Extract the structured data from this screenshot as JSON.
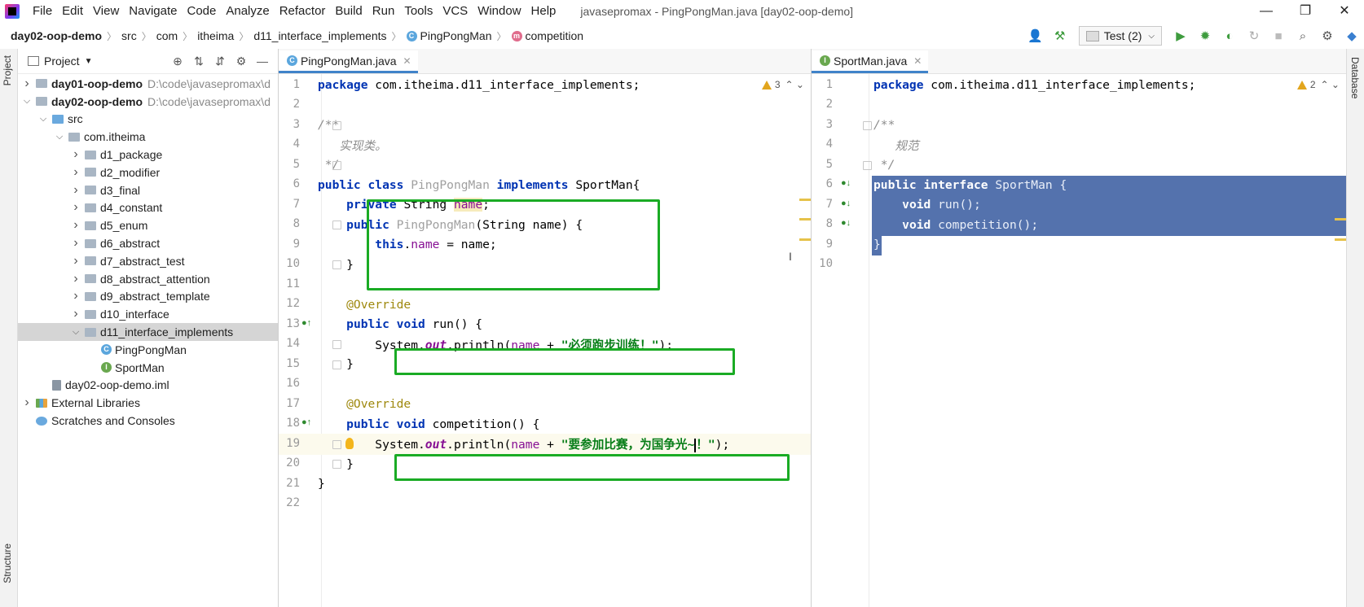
{
  "menubar": {
    "items": [
      "File",
      "Edit",
      "View",
      "Navigate",
      "Code",
      "Analyze",
      "Refactor",
      "Build",
      "Run",
      "Tools",
      "VCS",
      "Window",
      "Help"
    ],
    "title": "javasepromax - PingPongMan.java [day02-oop-demo]",
    "controls": {
      "minimize": "—",
      "restore": "❐",
      "close": "✕"
    }
  },
  "navbar": {
    "crumbs": [
      "day02-oop-demo",
      "src",
      "com",
      "itheima",
      "d11_interface_implements",
      "PingPongMan",
      "competition"
    ],
    "class_icon": "C",
    "method_icon": "m",
    "run_config": "Test (2)"
  },
  "side": {
    "project_tab": "Project",
    "structure_tab": "Structure",
    "database_tab": "Database"
  },
  "project": {
    "title": "Project",
    "tree": [
      {
        "label": "day01-oop-demo",
        "path": "D:\\code\\javasepromax\\d",
        "bold": true,
        "depth": 0,
        "arrow": ">",
        "icon": "folder"
      },
      {
        "label": "day02-oop-demo",
        "path": "D:\\code\\javasepromax\\d",
        "bold": true,
        "depth": 0,
        "arrow": "v",
        "icon": "folder"
      },
      {
        "label": "src",
        "depth": 1,
        "arrow": "v",
        "icon": "src"
      },
      {
        "label": "com.itheima",
        "depth": 2,
        "arrow": "v",
        "icon": "folder"
      },
      {
        "label": "d1_package",
        "depth": 3,
        "arrow": ">",
        "icon": "folder"
      },
      {
        "label": "d2_modifier",
        "depth": 3,
        "arrow": ">",
        "icon": "folder"
      },
      {
        "label": "d3_final",
        "depth": 3,
        "arrow": ">",
        "icon": "folder"
      },
      {
        "label": "d4_constant",
        "depth": 3,
        "arrow": ">",
        "icon": "folder"
      },
      {
        "label": "d5_enum",
        "depth": 3,
        "arrow": ">",
        "icon": "folder"
      },
      {
        "label": "d6_abstract",
        "depth": 3,
        "arrow": ">",
        "icon": "folder"
      },
      {
        "label": "d7_abstract_test",
        "depth": 3,
        "arrow": ">",
        "icon": "folder"
      },
      {
        "label": "d8_abstract_attention",
        "depth": 3,
        "arrow": ">",
        "icon": "folder"
      },
      {
        "label": "d9_abstract_template",
        "depth": 3,
        "arrow": ">",
        "icon": "folder"
      },
      {
        "label": "d10_interface",
        "depth": 3,
        "arrow": ">",
        "icon": "folder"
      },
      {
        "label": "d11_interface_implements",
        "depth": 3,
        "arrow": "v",
        "icon": "folder",
        "selected": true
      },
      {
        "label": "PingPongMan",
        "depth": 4,
        "arrow": "",
        "icon": "class"
      },
      {
        "label": "SportMan",
        "depth": 4,
        "arrow": "",
        "icon": "interface"
      },
      {
        "label": "day02-oop-demo.iml",
        "depth": 1,
        "arrow": "",
        "icon": "file"
      },
      {
        "label": "External Libraries",
        "depth": 0,
        "arrow": ">",
        "icon": "lib"
      },
      {
        "label": "Scratches and Consoles",
        "depth": 0,
        "arrow": "",
        "icon": "scratch"
      }
    ]
  },
  "editor_left": {
    "tab": "PingPongMan.java",
    "warnings": "3",
    "lines": [
      [
        [
          "kw",
          "package "
        ],
        [
          "cls",
          "com.itheima.d11_interface_implements;"
        ]
      ],
      [],
      [
        [
          "cmt",
          "/**"
        ]
      ],
      [
        [
          "cmt",
          "   实现类。"
        ]
      ],
      [
        [
          "cmt",
          " */"
        ]
      ],
      [
        [
          "kw",
          "public class "
        ],
        [
          "cls-un",
          "PingPongMan "
        ],
        [
          "kw",
          "implements "
        ],
        [
          "cls",
          "SportMan{"
        ]
      ],
      [
        [
          "cls",
          "    "
        ],
        [
          "kw",
          "private "
        ],
        [
          "cls",
          "String "
        ],
        [
          "fld-hl",
          "name"
        ],
        [
          "cls",
          ";"
        ]
      ],
      [
        [
          "cls",
          "    "
        ],
        [
          "kw",
          "public "
        ],
        [
          "cls-un",
          "PingPongMan"
        ],
        [
          "cls",
          "(String name) {"
        ]
      ],
      [
        [
          "cls",
          "        "
        ],
        [
          "kw",
          "this"
        ],
        [
          "cls",
          "."
        ],
        [
          "fld",
          "name"
        ],
        [
          "cls",
          " = name;"
        ]
      ],
      [
        [
          "cls",
          "    }"
        ]
      ],
      [],
      [
        [
          "ann",
          "    @Override"
        ]
      ],
      [
        [
          "cls",
          "    "
        ],
        [
          "kw",
          "public void "
        ],
        [
          "cls",
          "run() {"
        ]
      ],
      [
        [
          "cls",
          "        System."
        ],
        [
          "static",
          "out"
        ],
        [
          "cls",
          ".println("
        ],
        [
          "fld",
          "name"
        ],
        [
          "cls",
          " + "
        ],
        [
          "str",
          "\"必须跑步训练！\""
        ],
        [
          "cls",
          ");"
        ]
      ],
      [
        [
          "cls",
          "    }"
        ]
      ],
      [],
      [
        [
          "ann",
          "    @Override"
        ]
      ],
      [
        [
          "cls",
          "    "
        ],
        [
          "kw",
          "public void "
        ],
        [
          "cls",
          "competition() {"
        ]
      ],
      [
        [
          "cls",
          "        System."
        ],
        [
          "static",
          "out"
        ],
        [
          "cls",
          ".println("
        ],
        [
          "fld",
          "name"
        ],
        [
          "cls",
          " + "
        ],
        [
          "str",
          "\"要参加比赛，为国争光~"
        ],
        [
          "caret",
          ""
        ],
        [
          "str",
          "！\""
        ],
        [
          "cls",
          ");"
        ]
      ],
      [
        [
          "cls",
          "    }"
        ]
      ],
      [
        [
          "cls",
          "}"
        ]
      ],
      []
    ]
  },
  "editor_right": {
    "tab": "SportMan.java",
    "warnings": "2",
    "lines": [
      [
        [
          "kw",
          "package "
        ],
        [
          "cls",
          "com.itheima.d11_interface_implements;"
        ]
      ],
      [],
      [
        [
          "cmt",
          "/**"
        ]
      ],
      [
        [
          "cmt",
          "   规范"
        ]
      ],
      [
        [
          "cmt",
          " */"
        ]
      ],
      [
        [
          "sel-kw",
          "public interface "
        ],
        [
          "sel-text",
          "SportMan {"
        ]
      ],
      [
        [
          "sel-text",
          "    "
        ],
        [
          "sel-kw",
          "void "
        ],
        [
          "sel-text",
          "run();"
        ]
      ],
      [
        [
          "sel-text",
          "    "
        ],
        [
          "sel-kw",
          "void "
        ],
        [
          "sel-text",
          "competition();"
        ]
      ],
      [
        [
          "sel-text",
          "}"
        ]
      ],
      []
    ]
  },
  "colors": {
    "accent": "#4083c9",
    "highlight_box": "#1aab24",
    "selection": "#5472ad"
  }
}
